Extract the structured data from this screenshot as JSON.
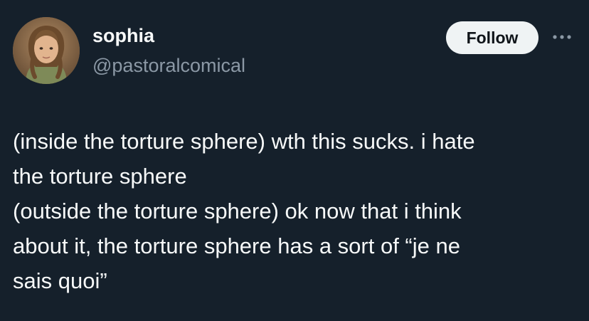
{
  "author": {
    "display_name": "sophia",
    "handle": "@pastoralcomical",
    "avatar_icon": "profile-photo"
  },
  "actions": {
    "follow_label": "Follow",
    "more_icon": "ellipsis-icon"
  },
  "tweet": {
    "lines": [
      "(inside the torture sphere) wth this sucks. i hate",
      "the torture sphere",
      "(outside the torture sphere) ok now that i think",
      "about it, the torture sphere has a sort of “je ne",
      "sais quoi”"
    ]
  },
  "colors": {
    "background": "#15202b",
    "primary_text": "#f7f9f9",
    "secondary_text": "#8b98a5",
    "follow_button_bg": "#eff3f4",
    "follow_button_text": "#0f1419"
  }
}
